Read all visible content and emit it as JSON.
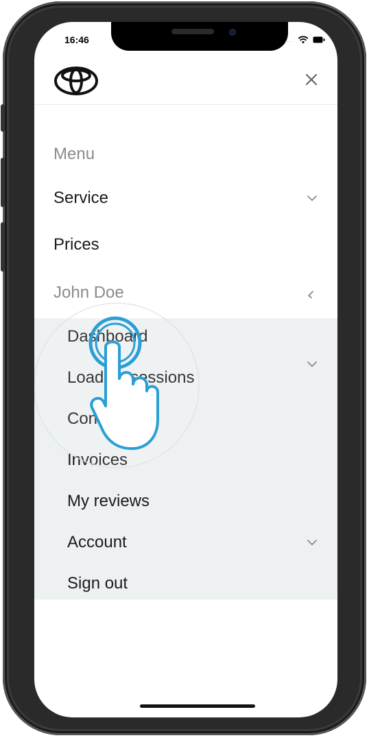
{
  "status_bar": {
    "time": "16:46",
    "carrier_dots": "....",
    "icons": [
      "wifi-icon",
      "battery-icon"
    ]
  },
  "header": {
    "logo_icon": "toyota-logo-icon",
    "close_icon": "close-icon"
  },
  "menu": {
    "title": "Menu",
    "items": [
      {
        "label": "Service",
        "has_chevron": true
      },
      {
        "label": "Prices",
        "has_chevron": false
      }
    ],
    "user": {
      "label": "John Doe",
      "expanded": true
    },
    "submenu": [
      {
        "label": "Dashboard",
        "has_chevron": false
      },
      {
        "label": "Loading sessions",
        "has_chevron": true
      },
      {
        "label": "Con",
        "has_chevron": false
      },
      {
        "label": "Invoices",
        "has_chevron": false
      },
      {
        "label": "My reviews",
        "has_chevron": false
      },
      {
        "label": "Account",
        "has_chevron": true
      },
      {
        "label": "Sign out",
        "has_chevron": false
      }
    ]
  },
  "colors": {
    "submenu_bg": "#edf1f2",
    "accent": "#2a9fd6",
    "text": "#1a1a1a",
    "muted": "#8a8a8a"
  }
}
